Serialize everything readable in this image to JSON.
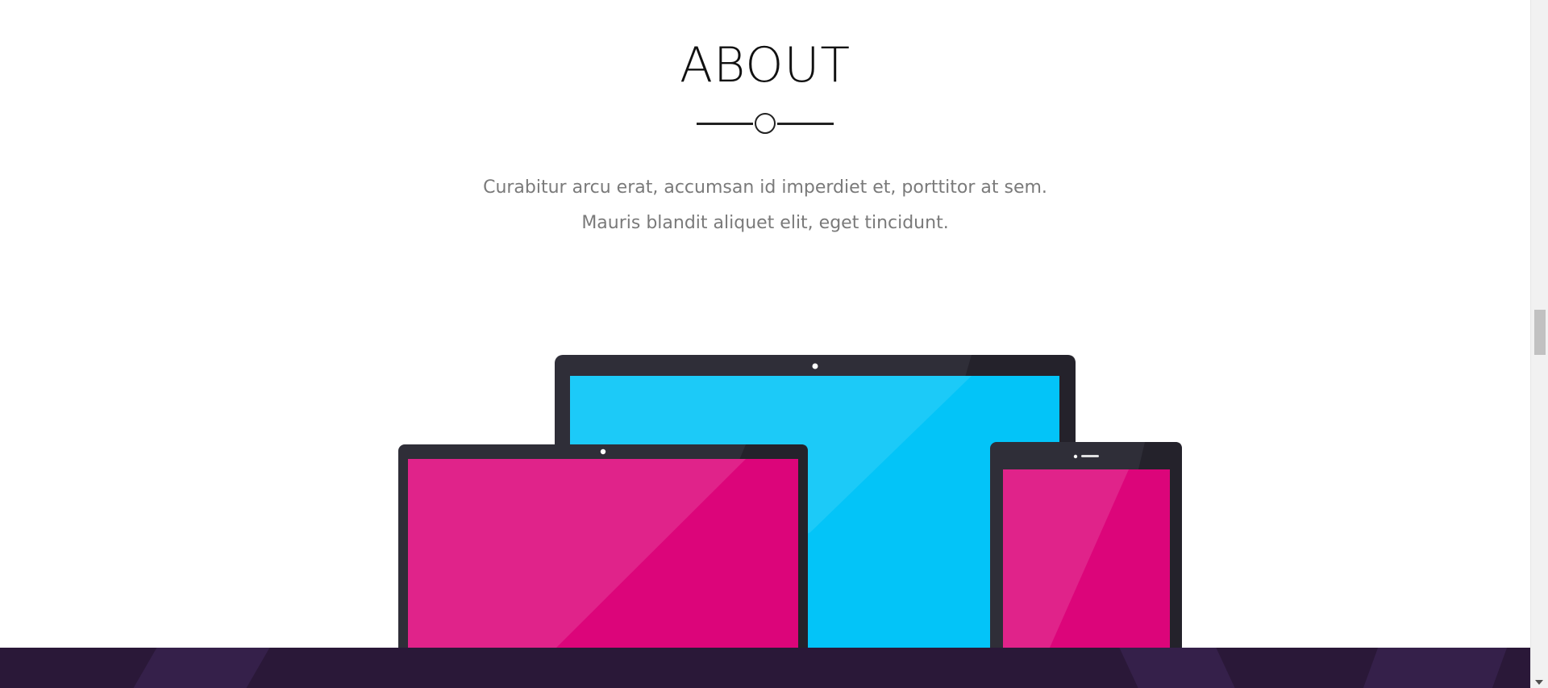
{
  "about": {
    "title": "ABOUT",
    "text": "Curabitur arcu erat, accumsan id imperdiet et, porttitor at sem. Mauris blandit aliquet elit, eget tincidunt."
  },
  "colors": {
    "title": "#111111",
    "body_text": "#7a7a7a",
    "divider": "#222222",
    "device_frame": "#2f2e38",
    "laptop_screen": "#03c4f8",
    "tablet_screen": "#dc057a",
    "footer_band": "#2a1838"
  },
  "icons": {
    "divider_ornament": "circle-divider-icon",
    "illustration": "devices-illustration-icon"
  }
}
